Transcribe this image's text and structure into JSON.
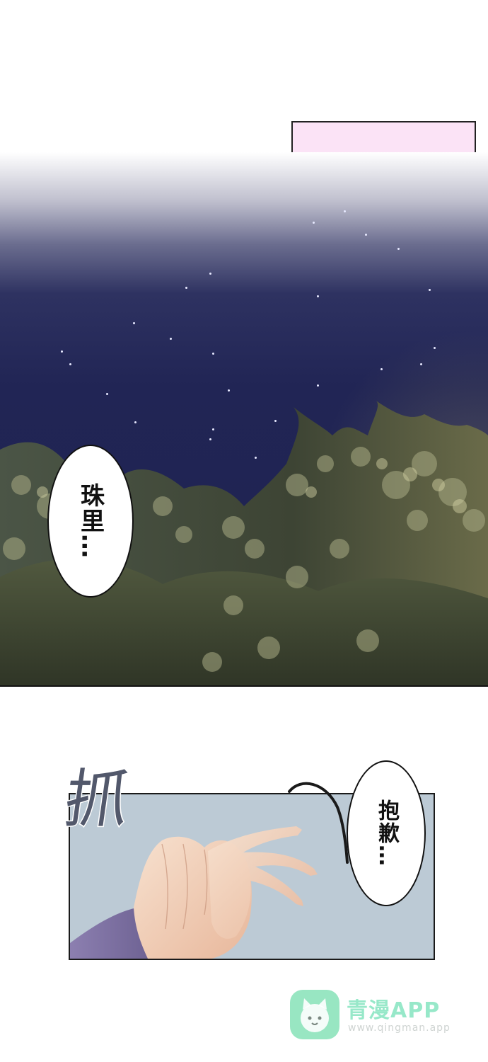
{
  "panel_1": {
    "speech": "珠里…"
  },
  "panel_2": {
    "sound_effect": "抓",
    "speech": "抱歉…"
  },
  "watermark": {
    "name": "青漫APP",
    "url": "www.qingman.app"
  },
  "colors": {
    "sky_dark": "#212555",
    "deco_pink": "#fbe3f6",
    "deco_purple": "#baaaf7",
    "hand_panel_bg": "#bccad5",
    "watermark_green": "#7fe0b4"
  }
}
